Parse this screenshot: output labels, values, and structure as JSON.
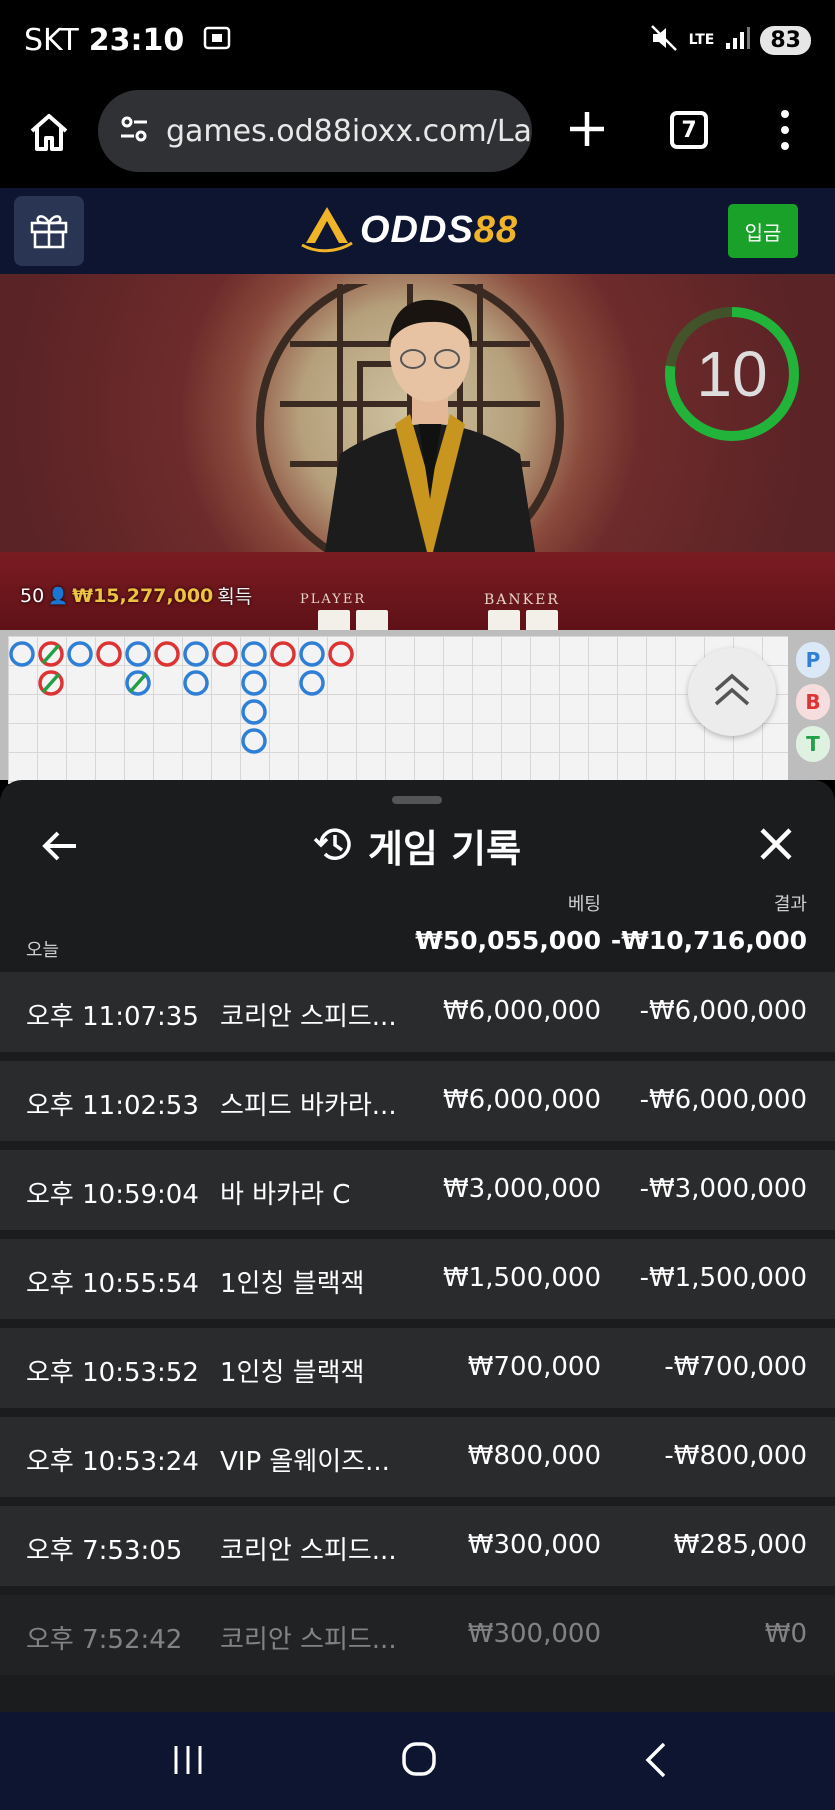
{
  "status_bar": {
    "carrier": "SKT",
    "time": "23:10",
    "network": "LTE",
    "battery": "83"
  },
  "browser": {
    "url": "games.od88ioxx.com/Laun",
    "tab_count": "7"
  },
  "site_header": {
    "logo_part1": "ODDS",
    "logo_part2": "88",
    "deposit_label": "입금",
    "brand_color": "#f0b429"
  },
  "video": {
    "countdown": "10",
    "viewer_count": "50",
    "win_amount": "₩15,277,000",
    "win_label": "획득",
    "table_label_player": "PLAYER",
    "table_label_banker": "BANKER"
  },
  "roadmap": {
    "side_pills": [
      "P",
      "B",
      "T"
    ]
  },
  "history": {
    "title": "게임 기록",
    "col_bet": "베팅",
    "col_result": "결과",
    "today_label": "오늘",
    "total_bet": "₩50,055,000",
    "total_result": "-₩10,716,000",
    "rows": [
      {
        "time": "오후 11:07:35",
        "game": "코리안 스피드...",
        "bet": "₩6,000,000",
        "result": "-₩6,000,000"
      },
      {
        "time": "오후 11:02:53",
        "game": "스피드 바카라...",
        "bet": "₩6,000,000",
        "result": "-₩6,000,000"
      },
      {
        "time": "오후 10:59:04",
        "game": "바 바카라 C",
        "bet": "₩3,000,000",
        "result": "-₩3,000,000"
      },
      {
        "time": "오후 10:55:54",
        "game": "1인칭 블랙잭",
        "bet": "₩1,500,000",
        "result": "-₩1,500,000"
      },
      {
        "time": "오후 10:53:52",
        "game": "1인칭 블랙잭",
        "bet": "₩700,000",
        "result": "-₩700,000"
      },
      {
        "time": "오후 10:53:24",
        "game": "VIP 올웨이즈...",
        "bet": "₩800,000",
        "result": "-₩800,000"
      },
      {
        "time": "오후 7:53:05",
        "game": "코리안 스피드...",
        "bet": "₩300,000",
        "result": "₩285,000"
      },
      {
        "time": "오후 7:52:42",
        "game": "코리안 스피드...",
        "bet": "₩300,000",
        "result": "₩0"
      }
    ]
  }
}
